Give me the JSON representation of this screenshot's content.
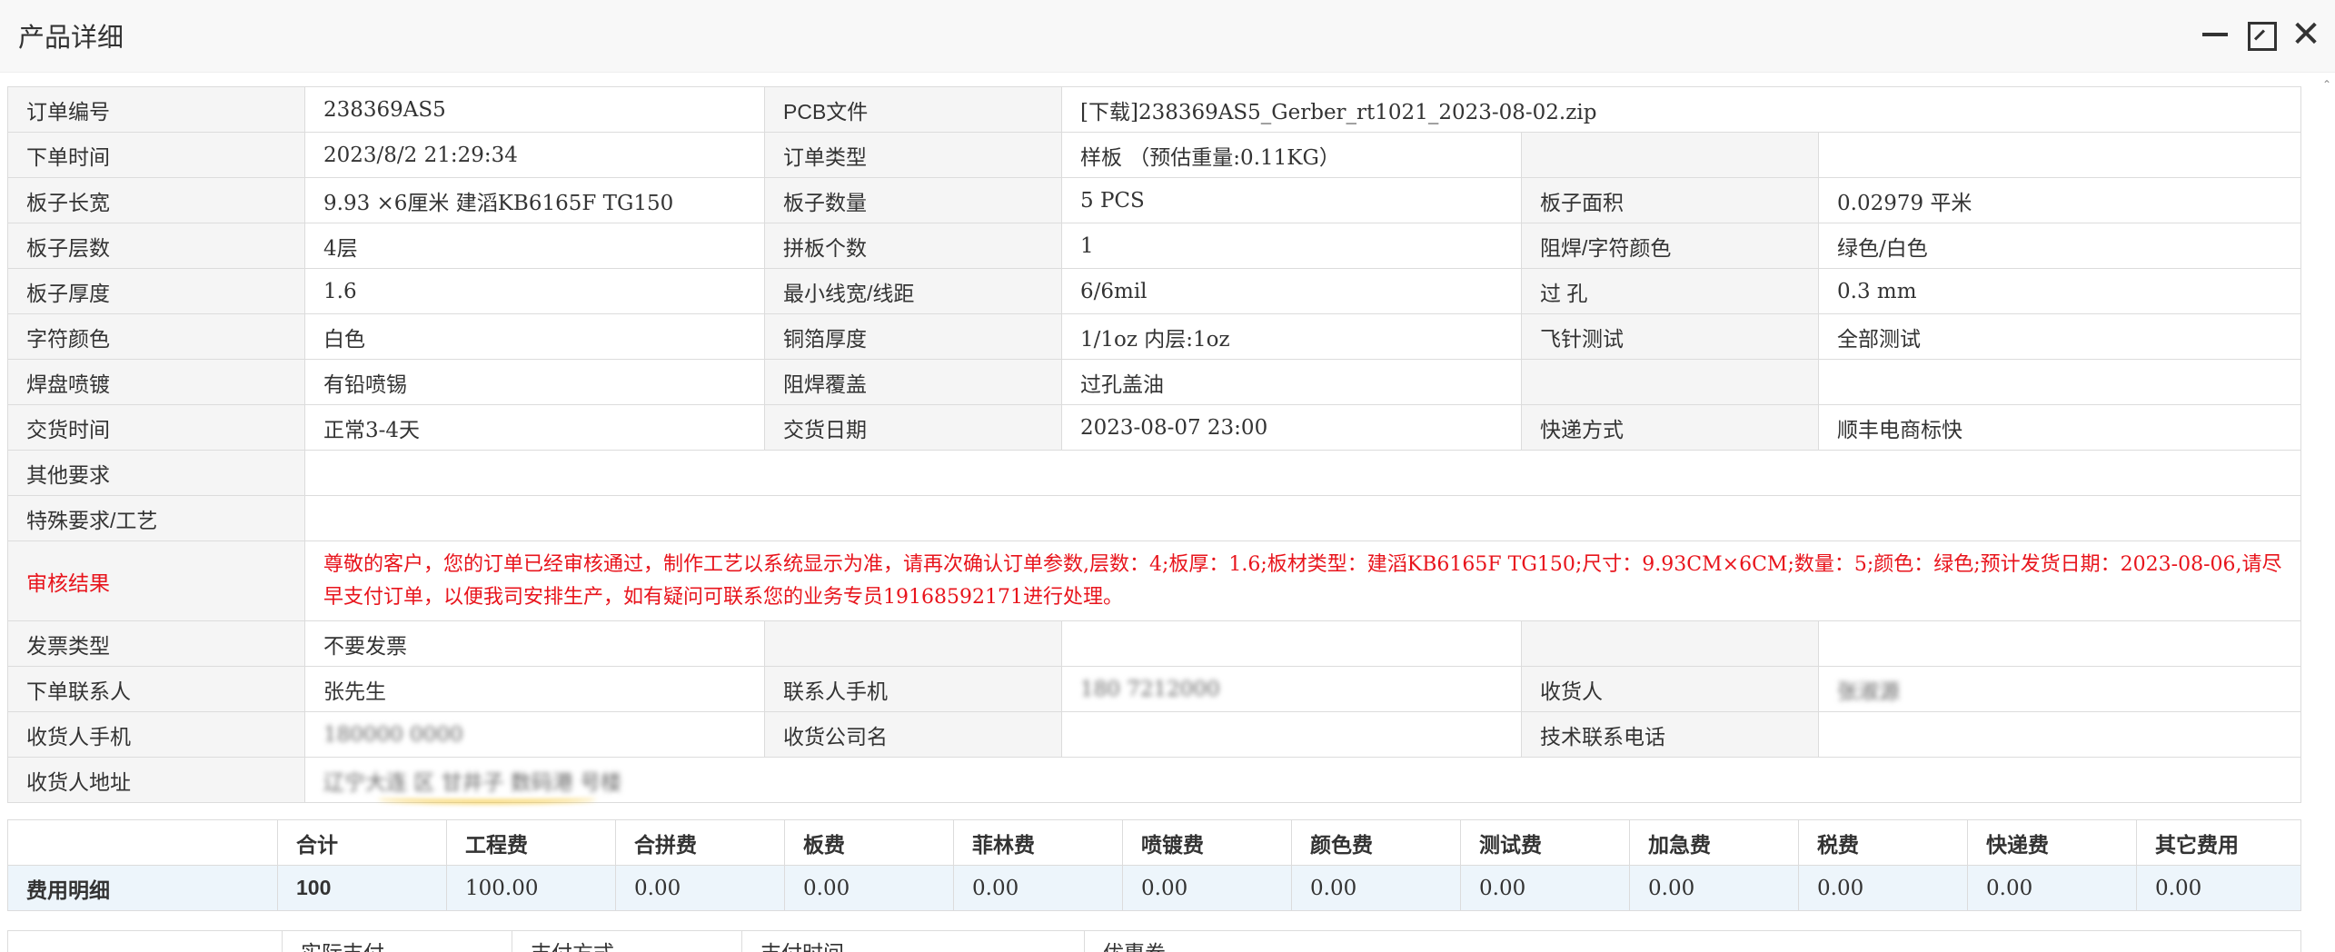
{
  "window": {
    "title": "产品详细",
    "minimize_icon": "minimize-icon",
    "maximize_icon": "maximize-icon",
    "close_icon": "close-icon",
    "close_glyph": "✕"
  },
  "details": {
    "order_no_label": "订单编号",
    "order_no": "238369AS5",
    "pcb_file_label": "PCB文件",
    "pcb_file": "[下载]238369AS5_Gerber_rt1021_2023-08-02.zip",
    "order_time_label": "下单时间",
    "order_time": "2023/8/2 21:29:34",
    "order_type_label": "订单类型",
    "order_type": "样板 （预估重量:0.11KG）",
    "board_size_label": "板子长宽",
    "board_size": "9.93 ×6厘米 建滔KB6165F TG150",
    "board_qty_label": "板子数量",
    "board_qty": "5 PCS",
    "board_area_label": "板子面积",
    "board_area": "0.02979 平米",
    "layers_label": "板子层数",
    "layers": "4层",
    "panel_count_label": "拼板个数",
    "panel_count": "1",
    "mask_color_label": "阻焊/字符颜色",
    "mask_color": "绿色/白色",
    "thickness_label": "板子厚度",
    "thickness": "1.6",
    "min_trace_label": "最小线宽/线距",
    "min_trace": "6/6mil",
    "via_label": "过 孔",
    "via": "0.3 mm",
    "silk_color_label": "字符颜色",
    "silk_color": "白色",
    "copper_label": "铜箔厚度",
    "copper": "1/1oz 内层:1oz",
    "flying_probe_label": "飞针测试",
    "flying_probe": "全部测试",
    "surface_label": "焊盘喷镀",
    "surface": "有铅喷锡",
    "mask_cover_label": "阻焊覆盖",
    "mask_cover": "过孔盖油",
    "delivery_time_label": "交货时间",
    "delivery_time": "正常3-4天",
    "delivery_date_label": "交货日期",
    "delivery_date": "2023-08-07 23:00",
    "shipping_label": "快递方式",
    "shipping": "顺丰电商标快",
    "other_req_label": "其他要求",
    "special_req_label": "特殊要求/工艺",
    "review_label": "审核结果",
    "review": "尊敬的客户，您的订单已经审核通过，制作工艺以系统显示为准，请再次确认订单参数,层数：4;板厚：1.6;板材类型：建滔KB6165F TG150;尺寸：9.93CM×6CM;数量：5;颜色：绿色;预计发货日期：2023-08-06,请尽早支付订单，以便我司安排生产，如有疑问可联系您的业务专员19168592171进行处理。",
    "invoice_label": "发票类型",
    "invoice": "不要发票",
    "contact_label": "下单联系人",
    "contact": "张先生",
    "contact_phone_label": "联系人手机",
    "contact_phone": "180 7212000",
    "receiver_label": "收货人",
    "receiver": "张淑源",
    "receiver_phone_label": "收货人手机",
    "receiver_phone": "180000 0000",
    "receiver_company_label": "收货公司名",
    "tech_phone_label": "技术联系电话",
    "receiver_addr_label": "收货人地址",
    "receiver_addr": "辽宁大连 区 甘井子 数码港 号楼"
  },
  "fees": {
    "headers": [
      "合计",
      "工程费",
      "合拼费",
      "板费",
      "菲林费",
      "喷镀费",
      "颜色费",
      "测试费",
      "加急费",
      "税费",
      "快递费",
      "其它费用"
    ],
    "row_label": "费用明细",
    "values": [
      "100",
      "100.00",
      "0.00",
      "0.00",
      "0.00",
      "0.00",
      "0.00",
      "0.00",
      "0.00",
      "0.00",
      "0.00",
      "0.00"
    ]
  },
  "payment": {
    "headers": [
      "实际支付",
      "支付方式",
      "支付时间",
      "优惠券"
    ]
  },
  "colors": {
    "label_bg": "#f5f5f5",
    "border": "#dcdcdc",
    "review_text": "#e8141c",
    "fee_row_bg": "#edf5fb"
  }
}
